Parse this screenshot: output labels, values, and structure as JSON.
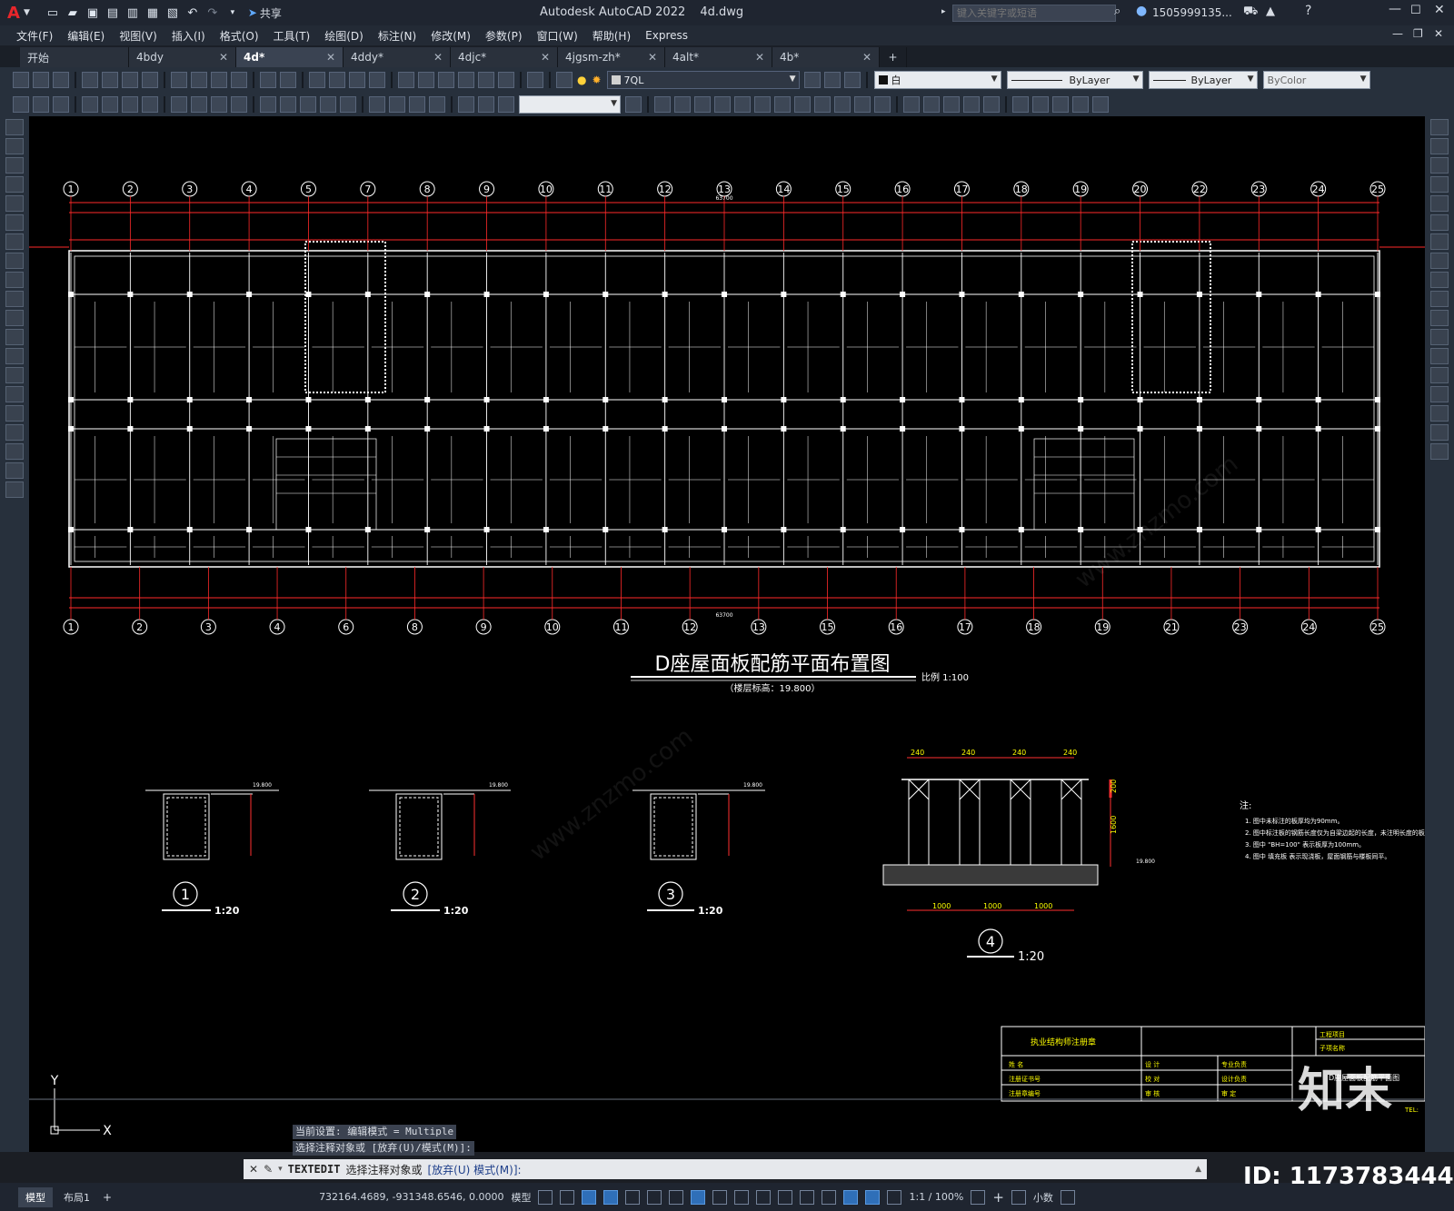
{
  "app": {
    "title": "Autodesk AutoCAD 2022",
    "filename": "4d.dwg",
    "share": "共享",
    "search_placeholder": "键入关键字或短语",
    "user": "1505999135...",
    "logo": "A"
  },
  "menu": [
    "文件(F)",
    "编辑(E)",
    "视图(V)",
    "插入(I)",
    "格式(O)",
    "工具(T)",
    "绘图(D)",
    "标注(N)",
    "修改(M)",
    "参数(P)",
    "窗口(W)",
    "帮助(H)",
    "Express"
  ],
  "tabs": [
    {
      "label": "开始",
      "closable": false
    },
    {
      "label": "4bdy",
      "closable": true
    },
    {
      "label": "4d*",
      "closable": true,
      "active": true
    },
    {
      "label": "4ddy*",
      "closable": true
    },
    {
      "label": "4djc*",
      "closable": true
    },
    {
      "label": "4jgsm-zh*",
      "closable": true
    },
    {
      "label": "4alt*",
      "closable": true
    },
    {
      "label": "4b*",
      "closable": true
    }
  ],
  "tab_add": "+",
  "layer_dropdown": "7QL",
  "color_dropdown": "白",
  "linetype_dropdown": "ByLayer",
  "lineweight_dropdown": "ByLayer",
  "plotstyle_dropdown": "ByColor",
  "drawing": {
    "top_axes": [
      "1",
      "2",
      "3",
      "4",
      "5",
      "7",
      "8",
      "9",
      "10",
      "11",
      "12",
      "13",
      "14",
      "15",
      "16",
      "17",
      "18",
      "19",
      "20",
      "22",
      "23",
      "24",
      "25"
    ],
    "bottom_axes": [
      "1",
      "2",
      "3",
      "4",
      "6",
      "8",
      "9",
      "10",
      "11",
      "12",
      "13",
      "15",
      "16",
      "17",
      "18",
      "19",
      "21",
      "23",
      "24",
      "25"
    ],
    "overall_dim": "63700",
    "title": "D座屋面板配筋平面布置图",
    "scale_label": "比例 1:100",
    "elevation": "（楼层标高：19.800）",
    "section_scale": "1:20",
    "section_labels": [
      "1",
      "2",
      "3",
      "4"
    ],
    "section4_dims": [
      "240",
      "240",
      "240",
      "240"
    ],
    "section4_spacings": [
      "1000",
      "1000",
      "1000"
    ],
    "section4_height": "1600",
    "section4_top": "200",
    "detail_elevation": "19.800",
    "notes_title": "注:",
    "notes": [
      "1. 图中未标注的板厚均为90mm。",
      "2. 图中标注板的钢筋长度仅为自梁边起的长度，未注明长度的板筋",
      "3. 图中 \"BH=100\" 表示板厚为100mm。",
      "4. 图中 填充板 表示现浇板，屋面钢筋与楼板同平。"
    ],
    "titleblock": {
      "stamp": "执业结构师注册章",
      "project": "工程项目",
      "subproject": "子项名称",
      "name": "姓    名",
      "cert": "注册证书号",
      "seal": "注册章编号",
      "design": "设  计",
      "check": "校  对",
      "review": "审  核",
      "chief": "专业负责",
      "design_lead": "设计负责",
      "approve": "审  定",
      "drawing_name": "D座屋面板配筋平面图",
      "tel": "TEL:"
    }
  },
  "ucs": {
    "y": "Y",
    "x": "X"
  },
  "command": {
    "history": [
      "当前设置: 编辑模式 = Multiple",
      "选择注释对象或 [放弃(U)/模式(M)]:"
    ],
    "cmd": "TEXTEDIT",
    "prompt": "选择注释对象或",
    "options": "[放弃(U) 模式(M)]:"
  },
  "layout_tabs": [
    "模型",
    "布局1"
  ],
  "status": {
    "coords": "732164.4689, -931348.6546, 0.0000",
    "mode": "模型",
    "scale": "1:1 / 100%",
    "units": "小数"
  },
  "watermark": {
    "brand": "知末",
    "id": "ID: 1173783444",
    "site": "www.znzmo.com"
  }
}
